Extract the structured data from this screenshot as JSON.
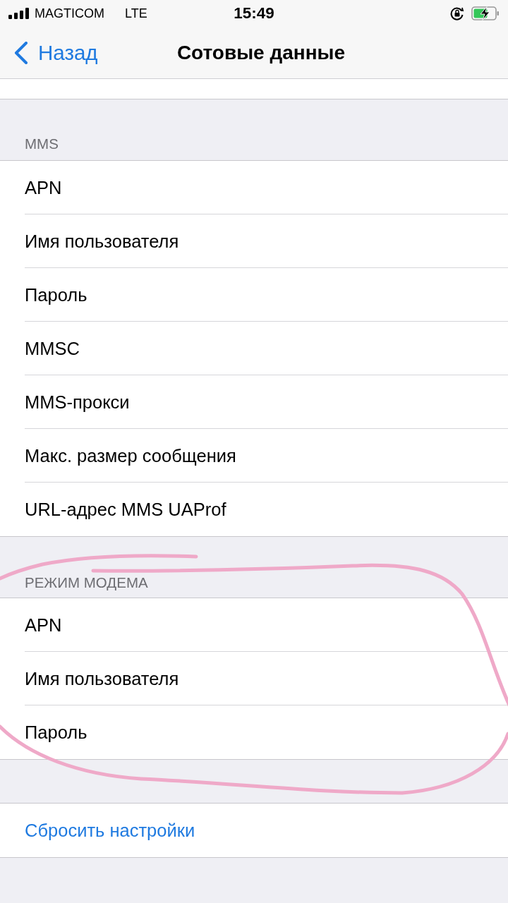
{
  "status_bar": {
    "carrier": "MAGTICOM",
    "network": "LTE",
    "time": "15:49",
    "charging": true
  },
  "nav": {
    "back": "Назад",
    "title": "Сотовые данные"
  },
  "sections": [
    {
      "header": "MMS",
      "rows": [
        {
          "kind": "field",
          "label": "APN"
        },
        {
          "kind": "field",
          "label": "Имя пользователя"
        },
        {
          "kind": "field",
          "label": "Пароль"
        },
        {
          "kind": "field",
          "label": "MMSC"
        },
        {
          "kind": "field",
          "label": "MMS-прокси"
        },
        {
          "kind": "field",
          "label": "Макс. размер сообщения"
        },
        {
          "kind": "field",
          "label": "URL-адрес MMS UAProf"
        }
      ]
    },
    {
      "header": "РЕЖИМ МОДЕМА",
      "rows": [
        {
          "kind": "field",
          "label": "APN"
        },
        {
          "kind": "field",
          "label": "Имя пользователя"
        },
        {
          "kind": "field",
          "label": "Пароль"
        }
      ]
    },
    {
      "rows": [
        {
          "kind": "action",
          "label": "Сбросить настройки"
        }
      ]
    }
  ]
}
